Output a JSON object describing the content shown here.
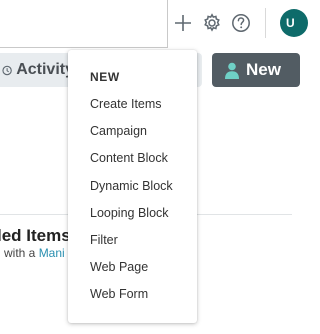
{
  "toolbar": {
    "icons": [
      "plus-icon",
      "gear-icon",
      "help-icon"
    ],
    "avatar_initial": "U",
    "avatar_color": "#0e6b6a"
  },
  "actions": {
    "activity_label": "Activity",
    "new_label": "New",
    "new_bg": "#525c63"
  },
  "section": {
    "title": "led Items",
    "subtitle_prefix": "l with a ",
    "subtitle_link": "Mani"
  },
  "menu": {
    "header": "NEW",
    "items": [
      "Create Items",
      "Campaign",
      "Content Block",
      "Dynamic Block",
      "Looping Block",
      "Filter",
      "Web Page",
      "Web Form"
    ]
  }
}
